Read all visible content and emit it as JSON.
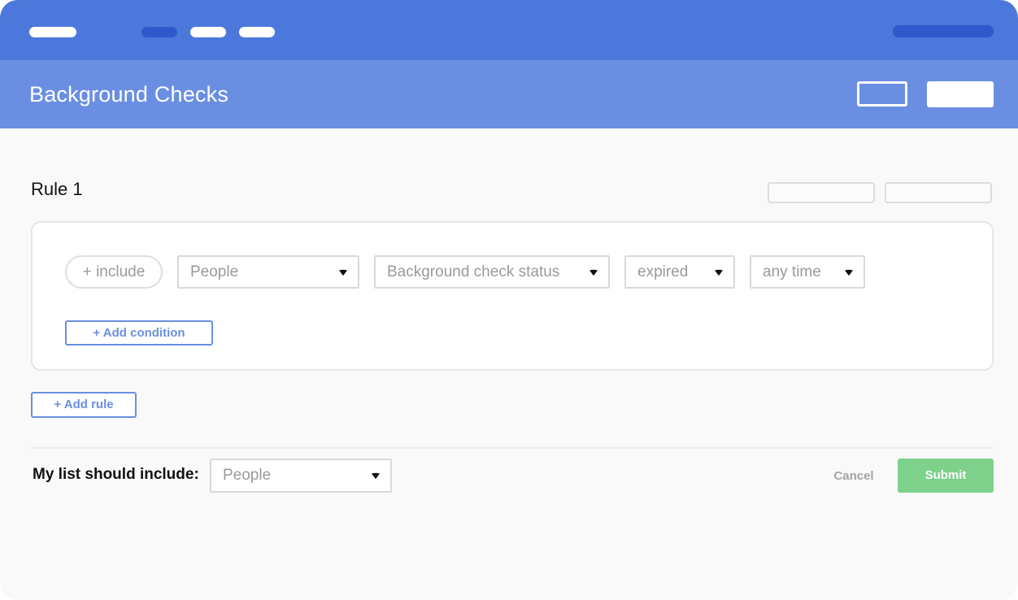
{
  "header": {
    "title": "Background Checks"
  },
  "rule": {
    "title": "Rule 1",
    "include_label": "+ include",
    "selects": [
      {
        "value": "People"
      },
      {
        "value": "Background check status"
      },
      {
        "value": "expired"
      },
      {
        "value": "any time"
      }
    ],
    "add_condition_label": "+ Add condition"
  },
  "add_rule_label": "+ Add rule",
  "footer": {
    "list_label": "My list should include:",
    "list_select_value": "People",
    "cancel_label": "Cancel",
    "submit_label": "Submit"
  },
  "colors": {
    "topbar": "#4c78dc",
    "header": "#6a8fe2",
    "accent": "#6a8fe2",
    "submit": "#7dd18b"
  },
  "icons": {
    "dropdown": "caret-down-icon"
  }
}
